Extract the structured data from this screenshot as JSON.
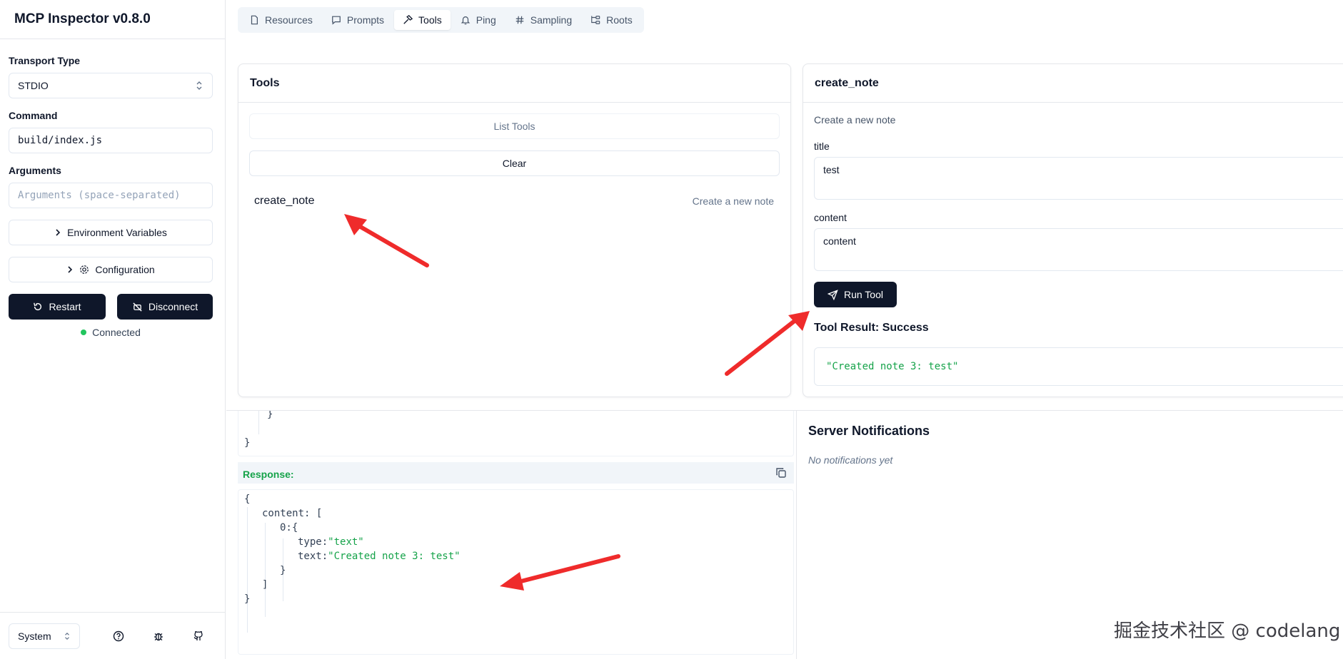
{
  "app": {
    "title": "MCP Inspector v0.8.0"
  },
  "sidebar": {
    "transport_label": "Transport Type",
    "transport_value": "STDIO",
    "command_label": "Command",
    "command_value": "build/index.js",
    "arguments_label": "Arguments",
    "arguments_placeholder": "Arguments (space-separated)",
    "env_button": "Environment Variables",
    "config_button": "Configuration",
    "restart_button": "Restart",
    "disconnect_button": "Disconnect",
    "status_text": "Connected",
    "status_color": "#22c55e",
    "theme_value": "System"
  },
  "tabs": [
    {
      "label": "Resources",
      "icon": "file-icon"
    },
    {
      "label": "Prompts",
      "icon": "message-icon"
    },
    {
      "label": "Tools",
      "icon": "hammer-icon",
      "active": true
    },
    {
      "label": "Ping",
      "icon": "bell-icon"
    },
    {
      "label": "Sampling",
      "icon": "hash-icon"
    },
    {
      "label": "Roots",
      "icon": "folder-tree-icon"
    }
  ],
  "tools_panel": {
    "title": "Tools",
    "list_button": "List Tools",
    "clear_button": "Clear",
    "items": [
      {
        "name": "create_note",
        "description": "Create a new note"
      }
    ]
  },
  "tool_detail": {
    "title": "create_note",
    "description": "Create a new note",
    "fields": [
      {
        "label": "title",
        "value": "test"
      },
      {
        "label": "content",
        "value": "content"
      }
    ],
    "run_button": "Run Tool",
    "result_title": "Tool Result: Success",
    "result_value": "\"Created note 3: test\""
  },
  "history": {
    "response_label": "Response:",
    "request_tail": [
      "}",
      "}"
    ],
    "response_lines": {
      "open": "{",
      "content_key": "content:",
      "content_open": "[",
      "item_key": "0:",
      "item_open": "{",
      "type_key": "type:",
      "type_val": "\"text\"",
      "text_key": "text:",
      "text_val": "\"Created note 3: test\"",
      "item_close": "}",
      "content_close": "]",
      "close": "}"
    }
  },
  "notifications": {
    "title": "Server Notifications",
    "empty_text": "No notifications yet"
  },
  "watermark": "掘金技术社区 @ codelang",
  "colors": {
    "accent_dark": "#0f172a",
    "success": "#16a34a",
    "annotation_arrow": "#ef2b2b"
  }
}
